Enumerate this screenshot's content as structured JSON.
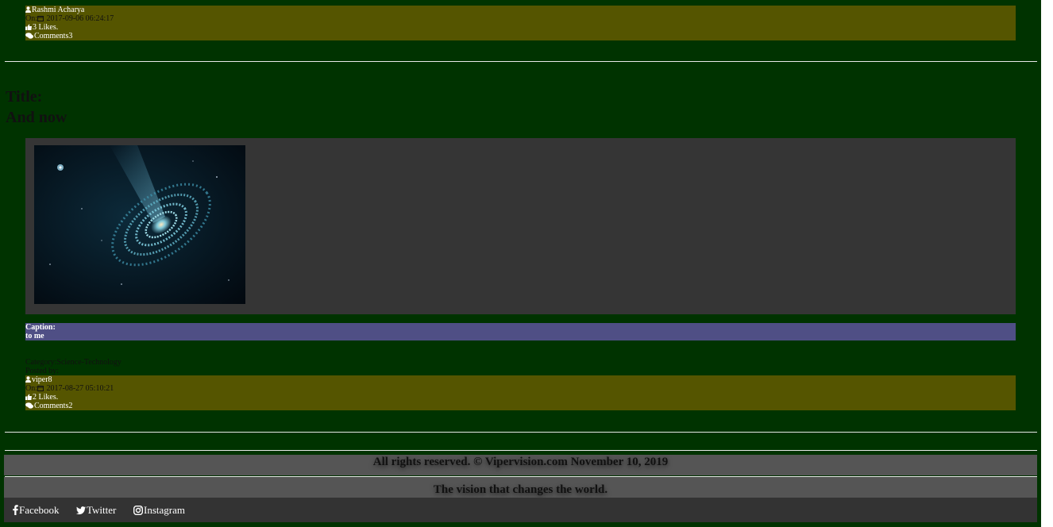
{
  "post1": {
    "author": "Rashmi Acharya",
    "on_label": "On:",
    "date": "2017-09-06 06:24:17",
    "likes": "3 Likes.",
    "comments": "Comments3"
  },
  "post2": {
    "title_label": "Title:",
    "title": "And now",
    "caption_label": "Caption:",
    "caption": "to me",
    "category": "Category:Science-Technology",
    "posted_by_label": "Posted by:",
    "author": "viper8",
    "on_label": "On:",
    "date": "2017-08-27 05:10:21",
    "likes": "2 Likes.",
    "comments": "Comments2"
  },
  "footer": {
    "rights": "All rights reserved. © Vipervision.com November 10, 2019",
    "tagline": "The vision that changes the world."
  },
  "social": {
    "facebook": "Facebook",
    "twitter": "Twitter",
    "instagram": "Instagram"
  },
  "icons": {
    "user": "user-icon",
    "calendar": "calendar-icon",
    "like": "thumbs-up-icon",
    "comments": "comments-icon",
    "facebook": "facebook-icon",
    "twitter": "twitter-icon",
    "instagram": "instagram-icon"
  },
  "colors": {
    "page_bg": "#003300",
    "meta_bg": "#555500",
    "image_panel_bg": "#353535",
    "caption_bg": "#4f4f85",
    "footer_bg": "#555555",
    "social_bg": "#333333"
  }
}
